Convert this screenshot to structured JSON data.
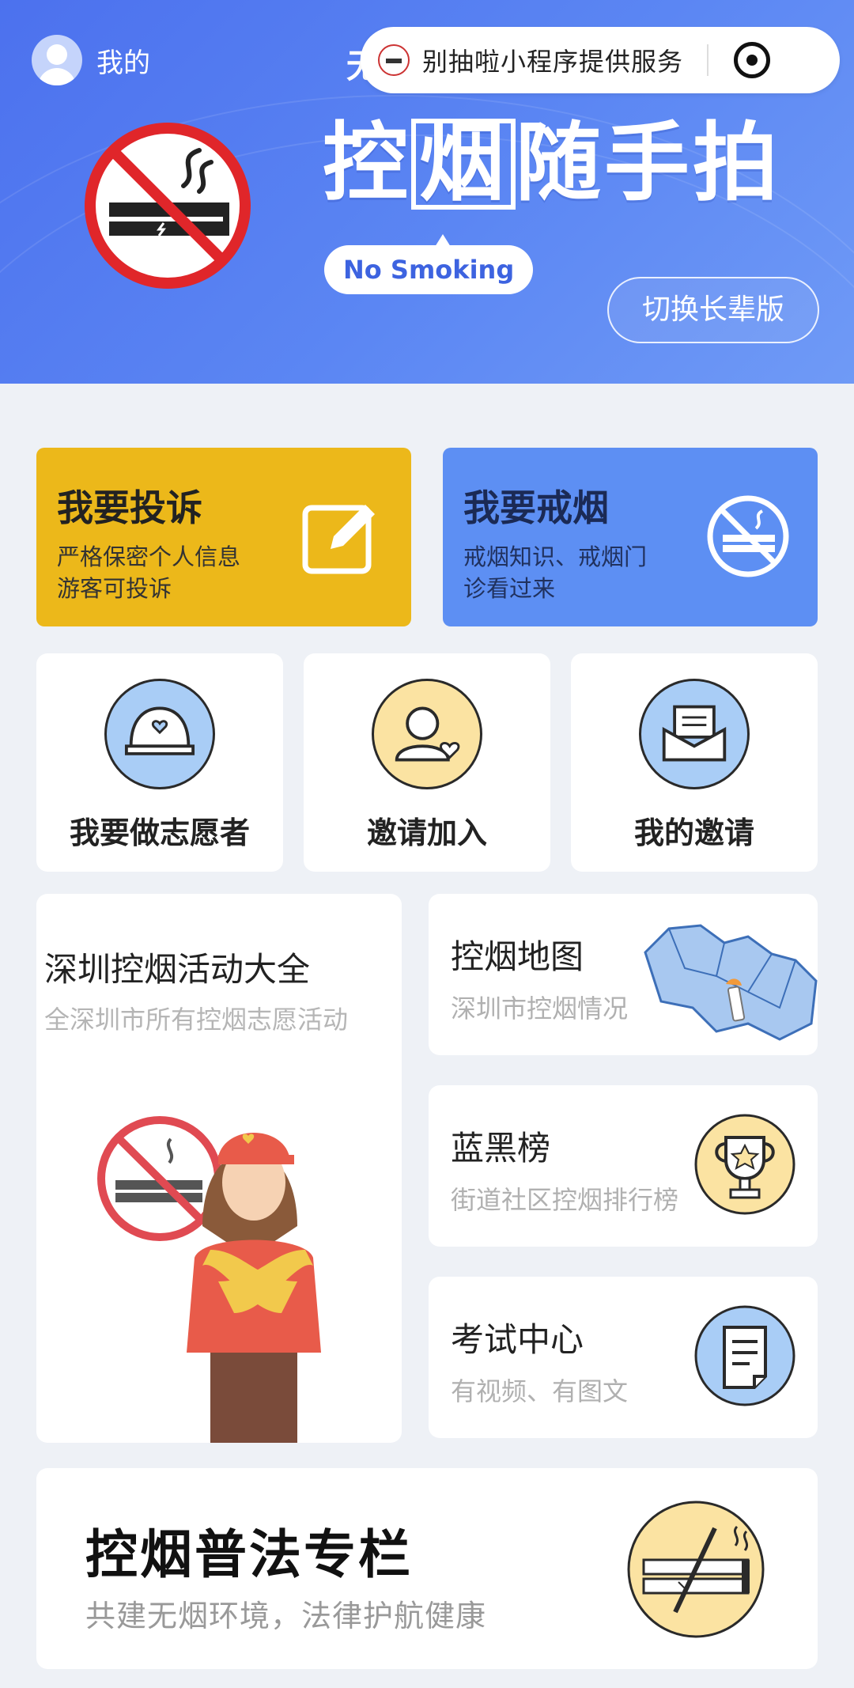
{
  "header": {
    "profile_label": "我的",
    "hidden_title_char": "无",
    "capsule_text": "别抽啦小程序提供服务",
    "hero_title_part1": "控",
    "hero_title_boxed": "烟",
    "hero_title_part2": "随手拍",
    "no_smoking": "No Smoking",
    "switch_label": "切换长辈版"
  },
  "actions": {
    "complain": {
      "title": "我要投诉",
      "line1": "严格保密个人信息",
      "line2": "游客可投诉"
    },
    "quit": {
      "title": "我要戒烟",
      "line1": "戒烟知识、戒烟门",
      "line2": "诊看过来"
    }
  },
  "grid": [
    {
      "label": "我要做志愿者",
      "icon": "volunteer-cap-icon"
    },
    {
      "label": "邀请加入",
      "icon": "invite-person-icon"
    },
    {
      "label": "我的邀请",
      "icon": "envelope-icon"
    }
  ],
  "activity": {
    "title": "深圳控烟活动大全",
    "sub": "全深圳市所有控烟志愿活动"
  },
  "side": {
    "map": {
      "title": "控烟地图",
      "sub": "深圳市控烟情况"
    },
    "rank": {
      "title": "蓝黑榜",
      "sub": "街道社区控烟排行榜"
    },
    "exam": {
      "title": "考试中心",
      "sub": "有视频、有图文"
    }
  },
  "law": {
    "title": "控烟普法专栏",
    "sub": "共建无烟环境，法律护航健康"
  },
  "colors": {
    "header_blue": "#4c71ee",
    "complain_yellow": "#ecb81a",
    "quit_blue": "#5d8ff3",
    "icon_light_blue": "#a9cdf6",
    "icon_light_yellow": "#fbe3a2"
  }
}
